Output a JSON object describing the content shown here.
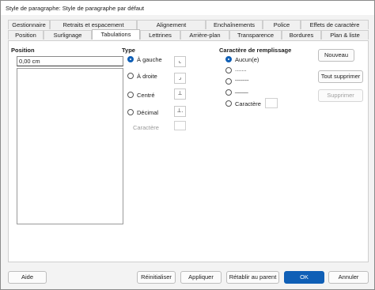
{
  "window": {
    "title": "Style de paragraphe: Style de paragraphe par défaut"
  },
  "tabs_row1": [
    "Gestionnaire",
    "Retraits et espacement",
    "Alignement",
    "Enchaînements",
    "Police",
    "Effets de caractère"
  ],
  "tabs_row2": [
    "Position",
    "Surlignage",
    "Tabulations",
    "Lettrines",
    "Arrière-plan",
    "Transparence",
    "Bordures",
    "Plan & liste"
  ],
  "active_tab": "Tabulations",
  "position": {
    "label": "Position",
    "value": "0,00 cm"
  },
  "type": {
    "label": "Type",
    "options": [
      {
        "label": "À gauche",
        "checked": true,
        "icon": "tab-left-icon",
        "glyph": "⌞"
      },
      {
        "label": "À droite",
        "checked": false,
        "icon": "tab-right-icon",
        "glyph": "⌟"
      },
      {
        "label": "Centré",
        "checked": false,
        "icon": "tab-center-icon",
        "glyph": "⊥"
      },
      {
        "label": "Décimal",
        "checked": false,
        "icon": "tab-decimal-icon",
        "glyph": "⊥."
      }
    ],
    "character_label": "Caractère"
  },
  "fill": {
    "label": "Caractère de remplissage",
    "options": [
      {
        "label": "Aucun(e)",
        "checked": true
      },
      {
        "label": ".......",
        "checked": false
      },
      {
        "label": "-------",
        "checked": false
      },
      {
        "label": "____",
        "checked": false
      },
      {
        "label": "Caractère",
        "checked": false
      }
    ]
  },
  "side_buttons": {
    "new": "Nouveau",
    "delete_all": "Tout supprimer",
    "delete": "Supprimer"
  },
  "footer": {
    "help": "Aide",
    "reset": "Réinitialiser",
    "apply": "Appliquer",
    "restore_parent": "Rétablir au parent",
    "ok": "OK",
    "cancel": "Annuler"
  },
  "colors": {
    "accent": "#0f5fb6",
    "panel": "#ffffff",
    "background": "#f3f3f3"
  }
}
